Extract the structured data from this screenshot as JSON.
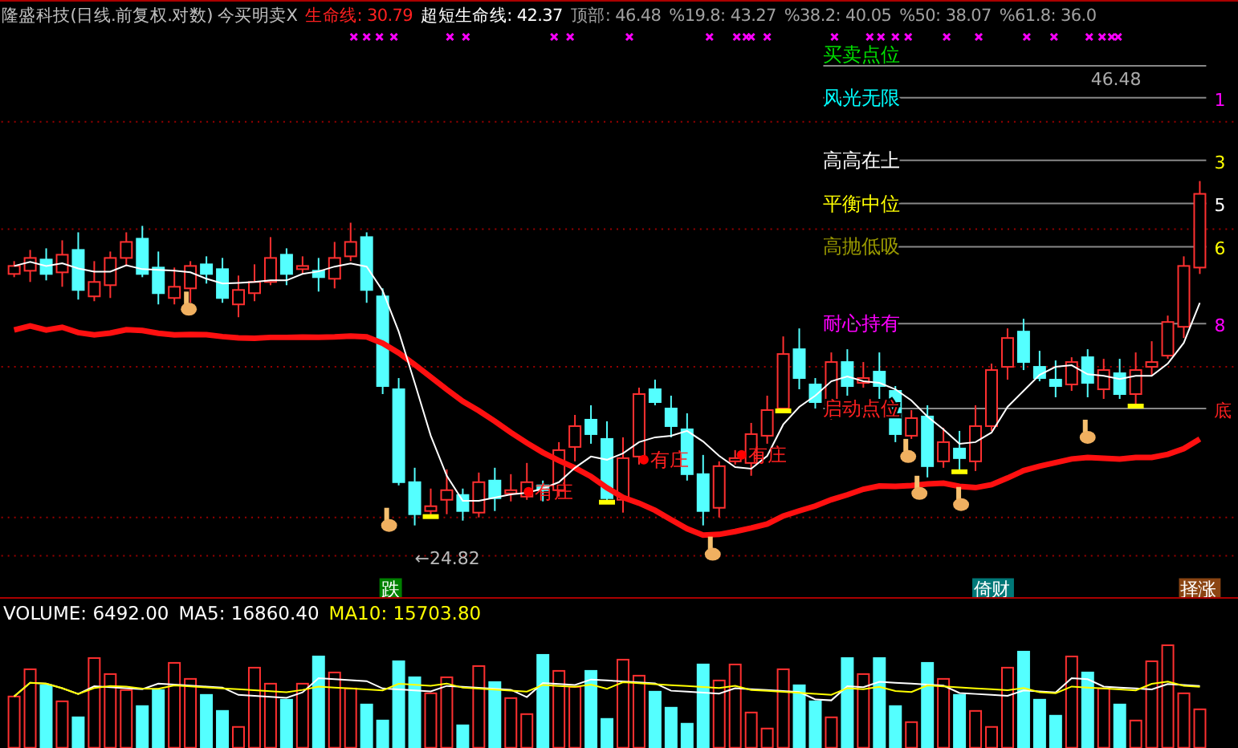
{
  "header": {
    "title": "隆盛科技(日线.前复权.对数) 今买明卖X",
    "indicators": [
      {
        "label": "生命线:",
        "value": "30.79",
        "color": "#ff2020"
      },
      {
        "label": "超短生命线:",
        "value": "42.37",
        "color": "#ffffff"
      }
    ],
    "top": {
      "label": "顶部:",
      "value": "46.48"
    },
    "fib_levels": [
      {
        "label": "%19.8:",
        "value": "43.27"
      },
      {
        "label": "%38.2:",
        "value": "40.05"
      },
      {
        "label": "%50:",
        "value": "38.07"
      },
      {
        "label": "%61.8:",
        "value": "36.0"
      }
    ]
  },
  "chart": {
    "top_level": {
      "label": "买卖点位",
      "value": "46.48",
      "color": "#00e000"
    },
    "levels": [
      {
        "label": "风光无限",
        "color": "#00ffff",
        "tag": {
          "text": "1",
          "color": "#ff00ff"
        }
      },
      {
        "label": "高高在上",
        "color": "#ffffff",
        "tag": {
          "text": "3",
          "color": "#ffff00"
        }
      },
      {
        "label": "平衡中位",
        "color": "#ffff00",
        "tag": {
          "text": "5",
          "color": "#ffffff"
        }
      },
      {
        "label": "高抛低吸",
        "color": "#999900",
        "tag": {
          "text": "6",
          "color": "#ffff00"
        }
      },
      {
        "label": "耐心持有",
        "color": "#ff00ff",
        "tag": {
          "text": "8",
          "color": "#ff00ff"
        }
      },
      {
        "label": "启动点位",
        "color": "#ff2020",
        "tag": {
          "text": "底",
          "color": "#ff2020"
        }
      }
    ],
    "low": "←24.82",
    "dealer_marks": [
      "有庄",
      "有庄",
      "有庄"
    ],
    "signals": [
      {
        "text": "跌",
        "color": "#008000"
      },
      {
        "text": "倚财",
        "color": "#007878"
      },
      {
        "text": "择涨",
        "color": "#8b4513"
      }
    ]
  },
  "volume": {
    "label": "VOLUME:",
    "value": "6492.00",
    "ma": [
      {
        "label": "MA5:",
        "value": "16860.40",
        "color": "#ffffff"
      },
      {
        "label": "MA10:",
        "value": "15703.80",
        "color": "#ffff00"
      }
    ]
  }
}
